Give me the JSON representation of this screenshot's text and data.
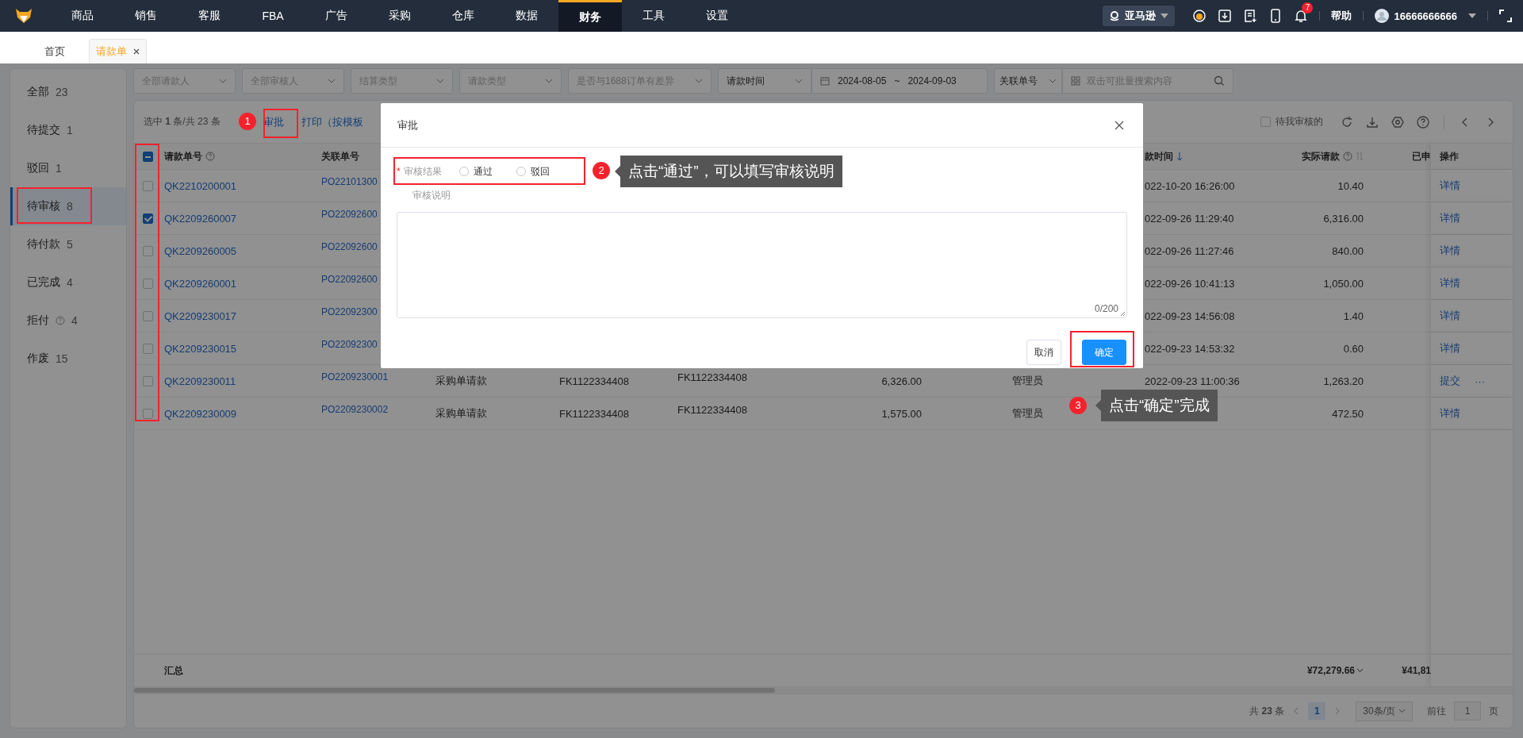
{
  "topnav": {
    "items": [
      {
        "label": "商品",
        "selected": false
      },
      {
        "label": "销售",
        "selected": false
      },
      {
        "label": "客服",
        "selected": false
      },
      {
        "label": "FBA",
        "selected": false
      },
      {
        "label": "广告",
        "selected": false
      },
      {
        "label": "采购",
        "selected": false
      },
      {
        "label": "仓库",
        "selected": false
      },
      {
        "label": "数据",
        "selected": false
      },
      {
        "label": "财务",
        "selected": true
      },
      {
        "label": "工具",
        "selected": false
      },
      {
        "label": "设置",
        "selected": false
      }
    ],
    "store": "亚马逊",
    "notifications": "7",
    "help": "帮助",
    "user": "16666666666"
  },
  "tabs": [
    {
      "label": "首页",
      "selected": false,
      "closable": false
    },
    {
      "label": "请款单",
      "selected": true,
      "closable": true
    }
  ],
  "sidebar": [
    {
      "label": "全部",
      "count": "23",
      "selected": false,
      "help": false
    },
    {
      "label": "待提交",
      "count": "1",
      "selected": false,
      "help": false
    },
    {
      "label": "驳回",
      "count": "1",
      "selected": false,
      "help": false
    },
    {
      "label": "待审核",
      "count": "8",
      "selected": true,
      "help": false
    },
    {
      "label": "待付款",
      "count": "5",
      "selected": false,
      "help": false
    },
    {
      "label": "已完成",
      "count": "4",
      "selected": false,
      "help": false
    },
    {
      "label": "拒付",
      "count": "4",
      "selected": false,
      "help": true
    },
    {
      "label": "作废",
      "count": "15",
      "selected": false,
      "help": false
    }
  ],
  "filters": [
    {
      "kind": "select",
      "placeholder": "全部请款人"
    },
    {
      "kind": "select",
      "placeholder": "全部审核人"
    },
    {
      "kind": "select",
      "placeholder": "结算类型"
    },
    {
      "kind": "select",
      "placeholder": "请款类型"
    },
    {
      "kind": "select",
      "placeholder": "是否与1688订单有差异"
    },
    {
      "kind": "select",
      "value": "请款时间"
    },
    {
      "kind": "daterange",
      "start": "2024-08-05",
      "separator": "~",
      "end": "2024-09-03"
    },
    {
      "kind": "select",
      "value": "关联单号"
    },
    {
      "kind": "search",
      "placeholder": "双击可批量搜索内容"
    }
  ],
  "toolbar": {
    "selection": "选中 **1** 条/共 23 条",
    "actions": [
      "审批",
      "打印（按模板"
    ],
    "pending_filter": {
      "label": "待我审核的",
      "checked": false
    }
  },
  "table": {
    "select_all_partial": true,
    "header": {
      "request_no": {
        "label": "请款单号",
        "help": true
      },
      "related_no": {
        "label": "关联单号"
      },
      "request_time": {
        "label": "款时间",
        "sorted_descending": true
      },
      "actual_amount": {
        "label": "实际请款",
        "help": true,
        "sortable": true
      },
      "applied": {
        "label": "已申"
      },
      "actions": {
        "label": "操作"
      }
    },
    "rows": [
      {
        "selected": false,
        "request_no": "QK2210200001",
        "related_no": "PO22101300",
        "request_time": "022-10-20 16:26:00",
        "actual_amount": "10.40",
        "actions": [
          "详情"
        ]
      },
      {
        "selected": true,
        "request_no": "QK2209260007",
        "related_no": "PO22092600",
        "request_time": "022-09-26 11:29:40",
        "actual_amount": "6,316.00",
        "actions": [
          "详情"
        ]
      },
      {
        "selected": false,
        "request_no": "QK2209260005",
        "related_no": "PO22092600",
        "request_time": "022-09-26 11:27:46",
        "actual_amount": "840.00",
        "actions": [
          "详情"
        ]
      },
      {
        "selected": false,
        "request_no": "QK2209260001",
        "related_no": "PO22092600",
        "request_time": "022-09-26 10:41:13",
        "actual_amount": "1,050.00",
        "actions": [
          "详情"
        ]
      },
      {
        "selected": false,
        "request_no": "QK2209230017",
        "related_no": "PO22092300",
        "request_time": "022-09-23 14:56:08",
        "actual_amount": "1.40",
        "actions": [
          "详情"
        ]
      },
      {
        "selected": false,
        "request_no": "QK2209230015",
        "related_no": "PO22092300",
        "request_time": "022-09-23 14:53:32",
        "actual_amount": "0.60",
        "actions": [
          "详情"
        ]
      },
      {
        "selected": false,
        "request_no": "QK2209230011",
        "related_no": "PO2209230001",
        "column_3": "采购单请款",
        "column_4": "FK1122334408",
        "column_5": "FK1122334408",
        "column_6": "6,326.00",
        "column_7": "管理员",
        "request_time": "2022-09-23 11:00:36",
        "actual_amount": "1,263.20",
        "actions": [
          "提交",
          "···"
        ]
      },
      {
        "selected": false,
        "request_no": "QK2209230009",
        "related_no": "PO2209230002",
        "column_3": "采购单请款",
        "column_4": "FK1122334408",
        "column_5": "FK1122334408",
        "column_6": "1,575.00",
        "column_7": "管理员",
        "actual_amount": "472.50",
        "actions": [
          "详情"
        ]
      }
    ],
    "summary": {
      "label": "汇总",
      "actual_amount": "¥72,279.66",
      "applied": "¥41,81"
    }
  },
  "pagination": {
    "total_prefix": "共",
    "total": "23",
    "total_suffix": "条",
    "pages": [
      {
        "label": "1",
        "selected": true
      }
    ],
    "page_size": "30条/页",
    "goto_label": "前往",
    "goto_value": "1",
    "goto_suffix": "页"
  },
  "dialog": {
    "title": "审批",
    "required_mark": "*",
    "result_label": "审核结果",
    "options": [
      {
        "label": "通过",
        "selected": false
      },
      {
        "label": "驳回",
        "selected": false
      }
    ],
    "note_label": "审核说明",
    "note_counter": "0/200",
    "buttons": [
      {
        "label": "取消",
        "kind": "default"
      },
      {
        "label": "确定",
        "kind": "primary"
      }
    ]
  },
  "steps": [
    {
      "number": "1"
    },
    {
      "number": "2",
      "text": "点击“通过”，可以填写审核说明"
    },
    {
      "number": "3",
      "text": "点击“确定”完成"
    }
  ]
}
